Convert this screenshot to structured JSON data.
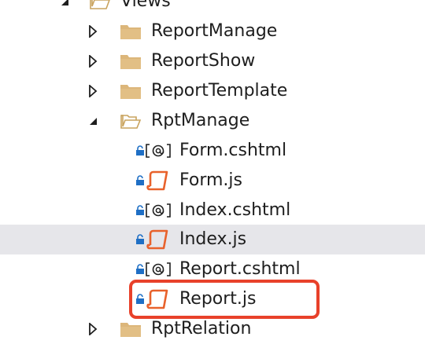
{
  "tree": {
    "items": [
      {
        "label": "Views",
        "type": "folder-open",
        "expanded": true
      },
      {
        "label": "ReportManage",
        "type": "folder",
        "expanded": false
      },
      {
        "label": "ReportShow",
        "type": "folder",
        "expanded": false
      },
      {
        "label": "ReportTemplate",
        "type": "folder",
        "expanded": false
      },
      {
        "label": "RptManage",
        "type": "folder-open",
        "expanded": true
      },
      {
        "label": "Form.cshtml",
        "type": "cshtml"
      },
      {
        "label": "Form.js",
        "type": "js"
      },
      {
        "label": "Index.cshtml",
        "type": "cshtml"
      },
      {
        "label": "Index.js",
        "type": "js",
        "selected": true
      },
      {
        "label": "Report.cshtml",
        "type": "cshtml"
      },
      {
        "label": "Report.js",
        "type": "js",
        "highlighted": true
      },
      {
        "label": "RptRelation",
        "type": "folder",
        "expanded": false
      }
    ]
  },
  "colors": {
    "folder": "#dcb67a",
    "js_icon": "#e8622c",
    "lock": "#1f6fc5",
    "highlight_border": "#e8412a",
    "selected_row": "#e6e6ea"
  }
}
